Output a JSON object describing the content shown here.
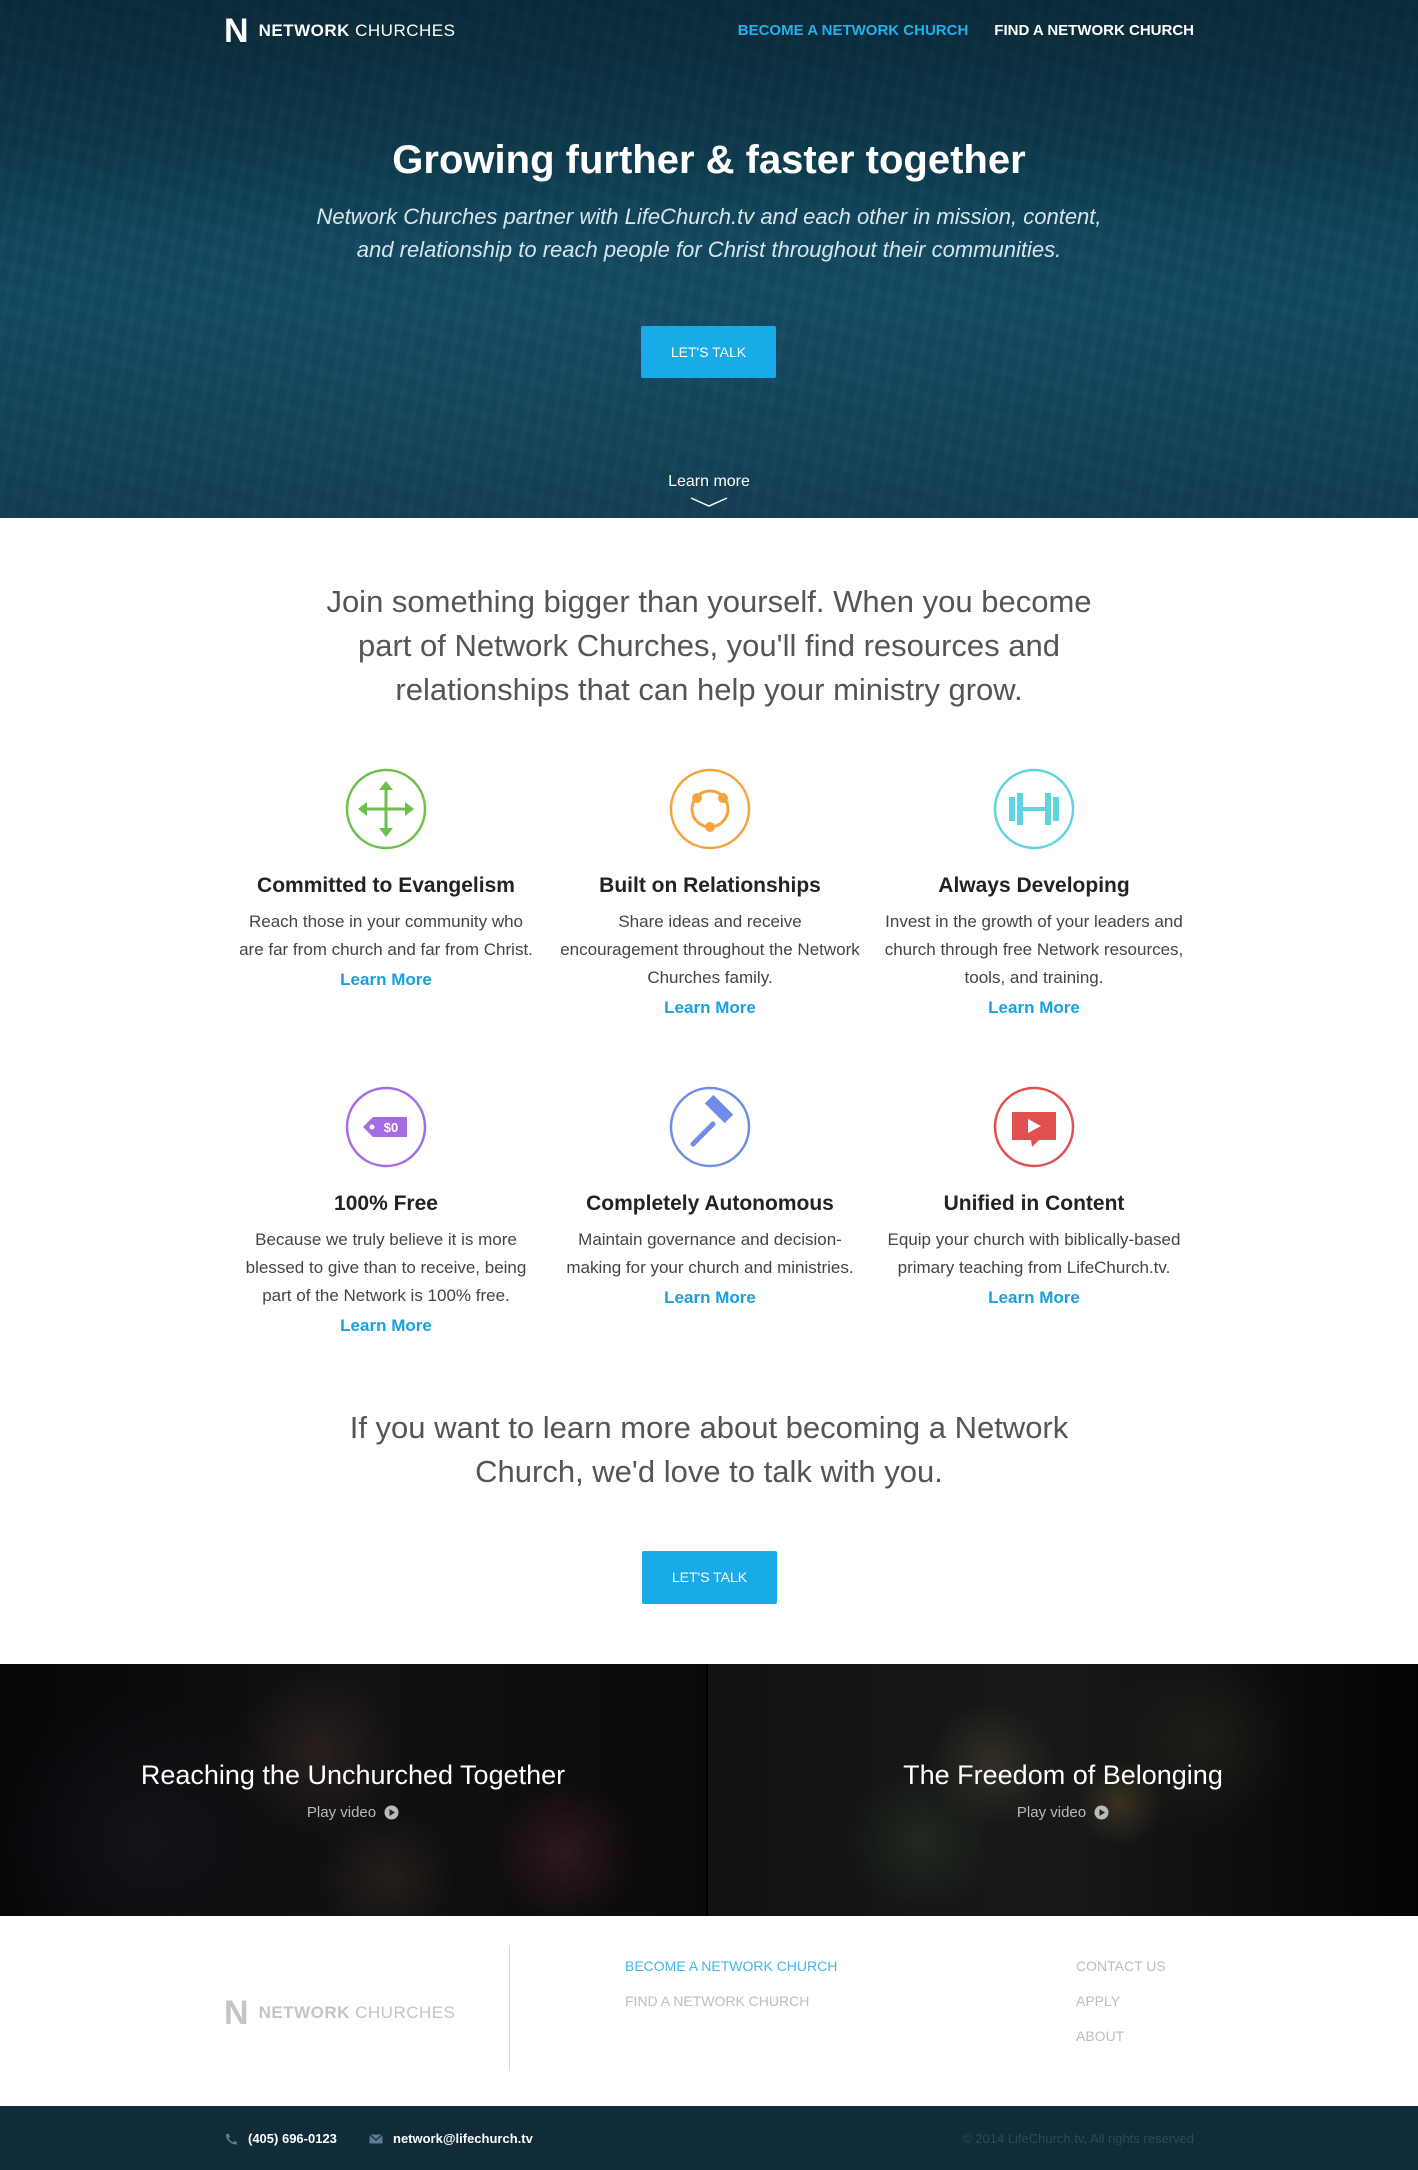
{
  "brand": {
    "mark": "N",
    "name_bold": "NETWORK",
    "name_light": "CHURCHES"
  },
  "nav": {
    "become": "BECOME A NETWORK CHURCH",
    "find": "FIND A NETWORK CHURCH"
  },
  "hero": {
    "title": "Growing further & faster together",
    "subtitle": "Network Churches partner with LifeChurch.tv and each other in mission, content, and relationship to reach people for Christ throughout their communities.",
    "cta": "LET'S TALK",
    "learn_more": "Learn more"
  },
  "intro": "Join something bigger than yourself. When you become part of Network Churches, you'll find resources and relationships that can help your ministry grow.",
  "features": [
    {
      "icon": "arrows-cross-icon",
      "color": "#6cc04a",
      "title": "Committed to Evangelism",
      "desc": "Reach those in your community who are far from church and far from Christ.",
      "link": "Learn More"
    },
    {
      "icon": "relationship-circle-icon",
      "color": "#f5a33a",
      "title": "Built on Relationships",
      "desc": "Share ideas and receive encouragement throughout the Network Churches family.",
      "link": "Learn More"
    },
    {
      "icon": "dumbbell-icon",
      "color": "#5fd3e0",
      "title": "Always Developing",
      "desc": "Invest in the growth of your leaders and church through free Network resources, tools, and training.",
      "link": "Learn More"
    },
    {
      "icon": "price-tag-icon",
      "color": "#a56be0",
      "title": "100% Free",
      "desc": "Because we truly believe it is more blessed to give than to receive, being part of the Network is 100% free.",
      "link": "Learn More"
    },
    {
      "icon": "gavel-icon",
      "color": "#6f8ce8",
      "title": "Completely Autonomous",
      "desc": "Maintain governance and decision-making for your church and ministries.",
      "link": "Learn More"
    },
    {
      "icon": "video-bubble-icon",
      "color": "#e05050",
      "title": "Unified in Content",
      "desc": "Equip your church with biblically-based primary teaching from LifeChurch.tv.",
      "link": "Learn More"
    }
  ],
  "cta_section": {
    "text": "If you want to learn more about becoming a Network Church, we'd love to talk with you.",
    "button": "LET'S TALK"
  },
  "videos": [
    {
      "title": "Reaching the Unchurched Together",
      "play": "Play video"
    },
    {
      "title": "The Freedom of Belonging",
      "play": "Play video"
    }
  ],
  "footer": {
    "col1": [
      "BECOME A NETWORK CHURCH",
      "FIND A NETWORK CHURCH"
    ],
    "col2": [
      "CONTACT US",
      "APPLY",
      "ABOUT"
    ],
    "phone": "(405) 696-0123",
    "email": "network@lifechurch.tv",
    "copyright": "© 2014 LifeChurch.tv, All rights reserved"
  },
  "colors": {
    "accent": "#19aae8",
    "link": "#19a0de",
    "footer_bar": "#102b39"
  }
}
